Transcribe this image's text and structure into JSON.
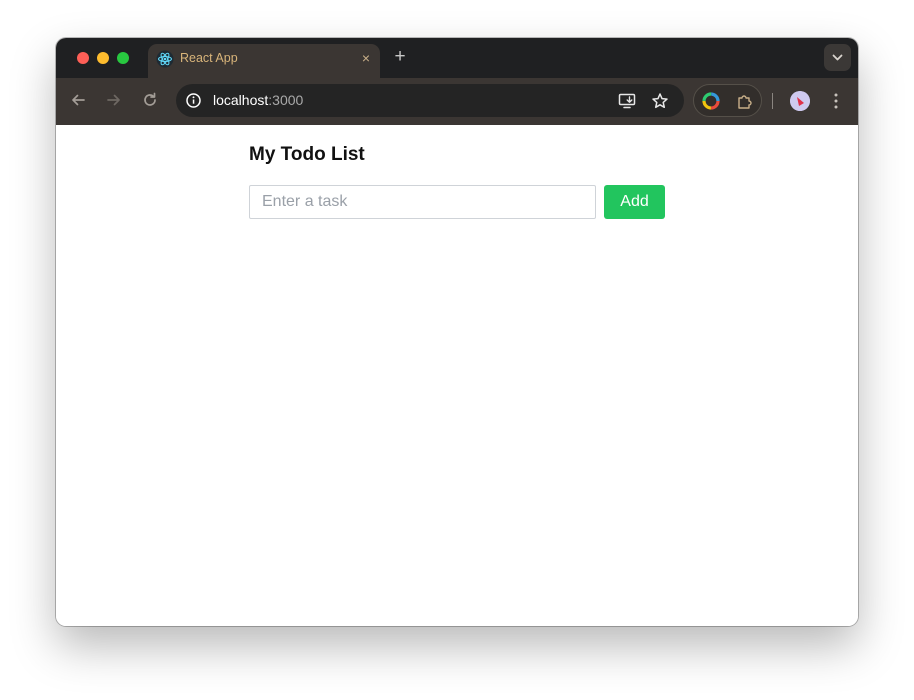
{
  "browser": {
    "tab": {
      "title": "React App",
      "close_glyph": "×",
      "favicon": "react-logo-icon"
    },
    "new_tab_glyph": "+",
    "address_bar": {
      "host": "localhost",
      "port": ":3000"
    },
    "icons": {
      "back": "back-arrow-icon",
      "forward": "forward-arrow-icon",
      "reload": "reload-icon",
      "site_info": "info-icon",
      "install_app": "install-app-icon",
      "bookmark": "star-icon",
      "extension_color": "color-wheel-icon",
      "extensions": "puzzle-icon",
      "profile": "avatar",
      "menu": "kebab-menu-icon",
      "tab_search": "chevron-down-icon"
    },
    "colors": {
      "titlebar": "#1f2022",
      "toolbar": "#3b3633",
      "tab_title": "#d8b47a"
    }
  },
  "app": {
    "title": "My Todo List",
    "task_input": {
      "placeholder": "Enter a task",
      "value": ""
    },
    "add_button_label": "Add",
    "accent_color": "#22c55e"
  }
}
